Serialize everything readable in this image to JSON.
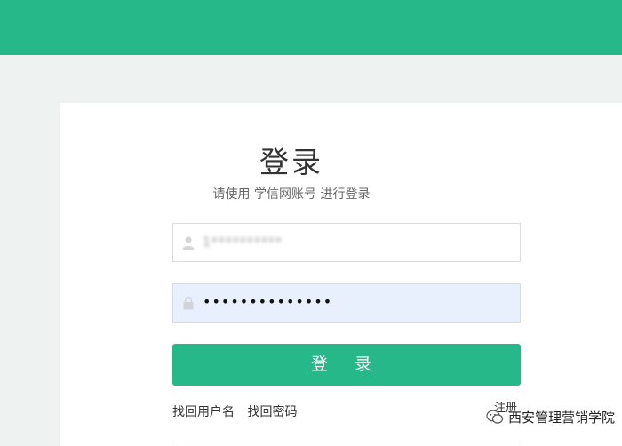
{
  "header": {},
  "login": {
    "title": "登录",
    "subtitle": "请使用 学信网账号 进行登录",
    "username_value": "1**********",
    "password_value": "••••••••••••••",
    "submit_label": "登 录",
    "forgot_username": "找回用户名",
    "forgot_password": "找回密码",
    "register": "注册"
  },
  "watermark": {
    "text": "西安管理营销学院"
  },
  "colors": {
    "brand_green": "#26b888",
    "autofill_blue": "#e8f0fe"
  }
}
